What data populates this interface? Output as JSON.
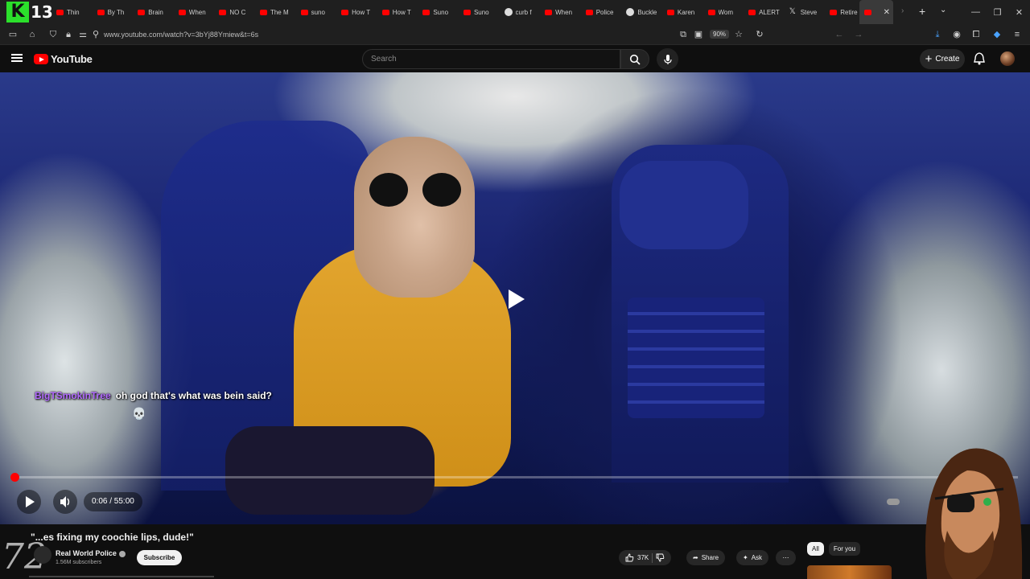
{
  "browser": {
    "badge_number": "13",
    "tabs": [
      {
        "label": "Thin",
        "icon": "youtube-favicon"
      },
      {
        "label": "By Th",
        "icon": "youtube-favicon"
      },
      {
        "label": "Brain",
        "icon": "youtube-favicon"
      },
      {
        "label": "When",
        "icon": "youtube-favicon"
      },
      {
        "label": "NO C",
        "icon": "youtube-favicon"
      },
      {
        "label": "The M",
        "icon": "youtube-favicon"
      },
      {
        "label": "suno",
        "icon": "youtube-favicon"
      },
      {
        "label": "How T",
        "icon": "youtube-favicon"
      },
      {
        "label": "How T",
        "icon": "youtube-favicon"
      },
      {
        "label": "Suno",
        "icon": "youtube-favicon"
      },
      {
        "label": "Suno",
        "icon": "youtube-favicon"
      },
      {
        "label": "curb f",
        "icon": "google-favicon"
      },
      {
        "label": "When",
        "icon": "youtube-favicon"
      },
      {
        "label": "Police",
        "icon": "youtube-favicon"
      },
      {
        "label": "Buckle",
        "icon": "circle-favicon"
      },
      {
        "label": "Karen",
        "icon": "youtube-favicon"
      },
      {
        "label": "Wom",
        "icon": "youtube-favicon"
      },
      {
        "label": "ALERT",
        "icon": "youtube-favicon"
      },
      {
        "label": "Steve",
        "icon": "x-favicon"
      },
      {
        "label": "Retire",
        "icon": "youtube-favicon"
      }
    ],
    "url": "www.youtube.com/watch?v=3bYj88Ymiew&t=6s",
    "zoom": "90%"
  },
  "youtube": {
    "logo_text": "YouTube",
    "search_placeholder": "Search",
    "create_label": "Create"
  },
  "player": {
    "progress_fraction": 0.0018,
    "time_text": "0:06 / 55:00",
    "chat_user": "BigTSmokinTree",
    "chat_message": "oh god that's what was bein said?",
    "chat_emoji": "💀"
  },
  "video_info": {
    "title": "\"...es fixing my coochie lips, dude!\"",
    "watermark": "72",
    "channel_name": "Real World Police",
    "subscribers": "1.56M subscribers",
    "subscribe_label": "Subscribe",
    "likes": "37K",
    "share_label": "Share",
    "ask_label": "Ask",
    "chips": [
      "All",
      "For you"
    ]
  },
  "colors": {
    "accent": "#ff0000",
    "chat_user": "#b36bff",
    "background": "#0f0f0f"
  }
}
